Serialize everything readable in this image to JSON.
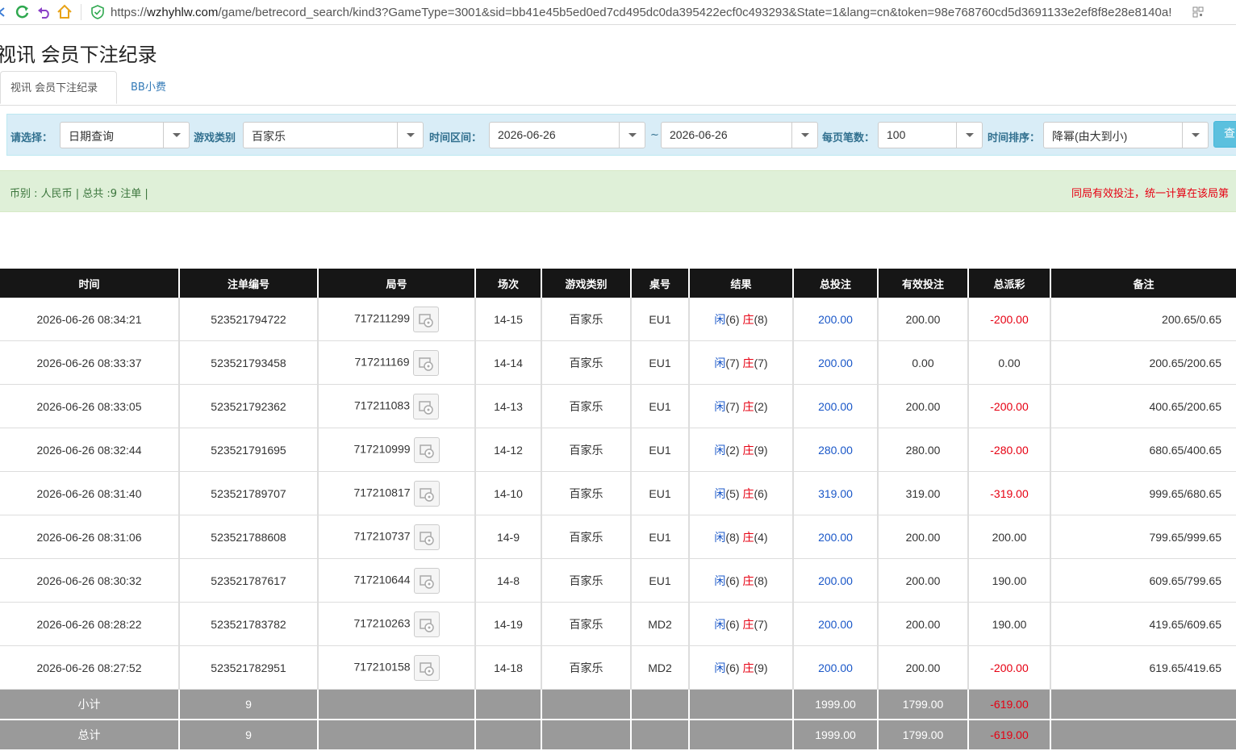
{
  "browser": {
    "url_scheme": "https://",
    "url_host": "wzhyhlw.com",
    "url_path": "/game/betrecord_search/kind3?GameType=3001&sid=bb41e45b5ed0ed7cd495dc0da395422ecf0c493293&State=1&lang=cn&token=98e768760cd5d3691133e2ef8f8e28e8140a!"
  },
  "page": {
    "title": "视讯 会员下注纪录",
    "tabs": [
      "视讯 会员下注纪录",
      "BB小费"
    ]
  },
  "filter": {
    "select_label": "请选择：",
    "select_value": "日期查询",
    "game_label": "游戏类别",
    "game_value": "百家乐",
    "range_label": "时间区间：",
    "date_from": "2026-06-26",
    "tilde": "~",
    "date_to": "2026-06-26",
    "per_page_label": "每页笔数：",
    "per_page_value": "100",
    "sort_label": "时间排序：",
    "sort_value": "降幂(由大到小)",
    "query_button": "查询"
  },
  "summary": {
    "left": "币别 : 人民币 | 总共 :9 注单 |",
    "right": "同局有效投注，统一计算在该局第"
  },
  "table": {
    "headers": [
      "时间",
      "注单编号",
      "局号",
      "场次",
      "游戏类别",
      "桌号",
      "结果",
      "总投注",
      "有效投注",
      "总派彩",
      "备注"
    ],
    "player_label": "闲",
    "banker_label": "庄",
    "rows": [
      {
        "time": "2026-06-26 08:34:21",
        "bet_id": "523521794722",
        "round": "717211299",
        "session": "14-15",
        "game": "百家乐",
        "table": "EU1",
        "player": "(6)",
        "banker": "(8)",
        "total": "200.00",
        "valid": "200.00",
        "payout": "-200.00",
        "payout_neg": true,
        "note": "200.65/0.65"
      },
      {
        "time": "2026-06-26 08:33:37",
        "bet_id": "523521793458",
        "round": "717211169",
        "session": "14-14",
        "game": "百家乐",
        "table": "EU1",
        "player": "(7)",
        "banker": "(7)",
        "total": "200.00",
        "valid": "0.00",
        "payout": "0.00",
        "payout_neg": false,
        "note": "200.65/200.65"
      },
      {
        "time": "2026-06-26 08:33:05",
        "bet_id": "523521792362",
        "round": "717211083",
        "session": "14-13",
        "game": "百家乐",
        "table": "EU1",
        "player": "(7)",
        "banker": "(2)",
        "total": "200.00",
        "valid": "200.00",
        "payout": "-200.00",
        "payout_neg": true,
        "note": "400.65/200.65"
      },
      {
        "time": "2026-06-26 08:32:44",
        "bet_id": "523521791695",
        "round": "717210999",
        "session": "14-12",
        "game": "百家乐",
        "table": "EU1",
        "player": "(2)",
        "banker": "(9)",
        "total": "280.00",
        "valid": "280.00",
        "payout": "-280.00",
        "payout_neg": true,
        "note": "680.65/400.65"
      },
      {
        "time": "2026-06-26 08:31:40",
        "bet_id": "523521789707",
        "round": "717210817",
        "session": "14-10",
        "game": "百家乐",
        "table": "EU1",
        "player": "(5)",
        "banker": "(6)",
        "total": "319.00",
        "valid": "319.00",
        "payout": "-319.00",
        "payout_neg": true,
        "note": "999.65/680.65"
      },
      {
        "time": "2026-06-26 08:31:06",
        "bet_id": "523521788608",
        "round": "717210737",
        "session": "14-9",
        "game": "百家乐",
        "table": "EU1",
        "player": "(8)",
        "banker": "(4)",
        "total": "200.00",
        "valid": "200.00",
        "payout": "200.00",
        "payout_neg": false,
        "note": "799.65/999.65"
      },
      {
        "time": "2026-06-26 08:30:32",
        "bet_id": "523521787617",
        "round": "717210644",
        "session": "14-8",
        "game": "百家乐",
        "table": "EU1",
        "player": "(6)",
        "banker": "(8)",
        "total": "200.00",
        "valid": "200.00",
        "payout": "190.00",
        "payout_neg": false,
        "note": "609.65/799.65"
      },
      {
        "time": "2026-06-26 08:28:22",
        "bet_id": "523521783782",
        "round": "717210263",
        "session": "14-19",
        "game": "百家乐",
        "table": "MD2",
        "player": "(6)",
        "banker": "(7)",
        "total": "200.00",
        "valid": "200.00",
        "payout": "190.00",
        "payout_neg": false,
        "note": "419.65/609.65"
      },
      {
        "time": "2026-06-26 08:27:52",
        "bet_id": "523521782951",
        "round": "717210158",
        "session": "14-18",
        "game": "百家乐",
        "table": "MD2",
        "player": "(6)",
        "banker": "(9)",
        "total": "200.00",
        "valid": "200.00",
        "payout": "-200.00",
        "payout_neg": true,
        "note": "619.65/419.65"
      }
    ],
    "subtotal": {
      "label": "小计",
      "count": "9",
      "total": "1999.00",
      "valid": "1799.00",
      "payout": "-619.00"
    },
    "grandtotal": {
      "label": "总计",
      "count": "9",
      "total": "1999.00",
      "valid": "1799.00",
      "payout": "-619.00"
    }
  },
  "colors": {
    "header_bg": "#161616",
    "filter_bg": "#d9edf7",
    "summary_bg": "#dff0d8",
    "negative": "#e60012",
    "link_blue": "#1a57c8",
    "subtotal_bg": "#9a9a9a"
  }
}
